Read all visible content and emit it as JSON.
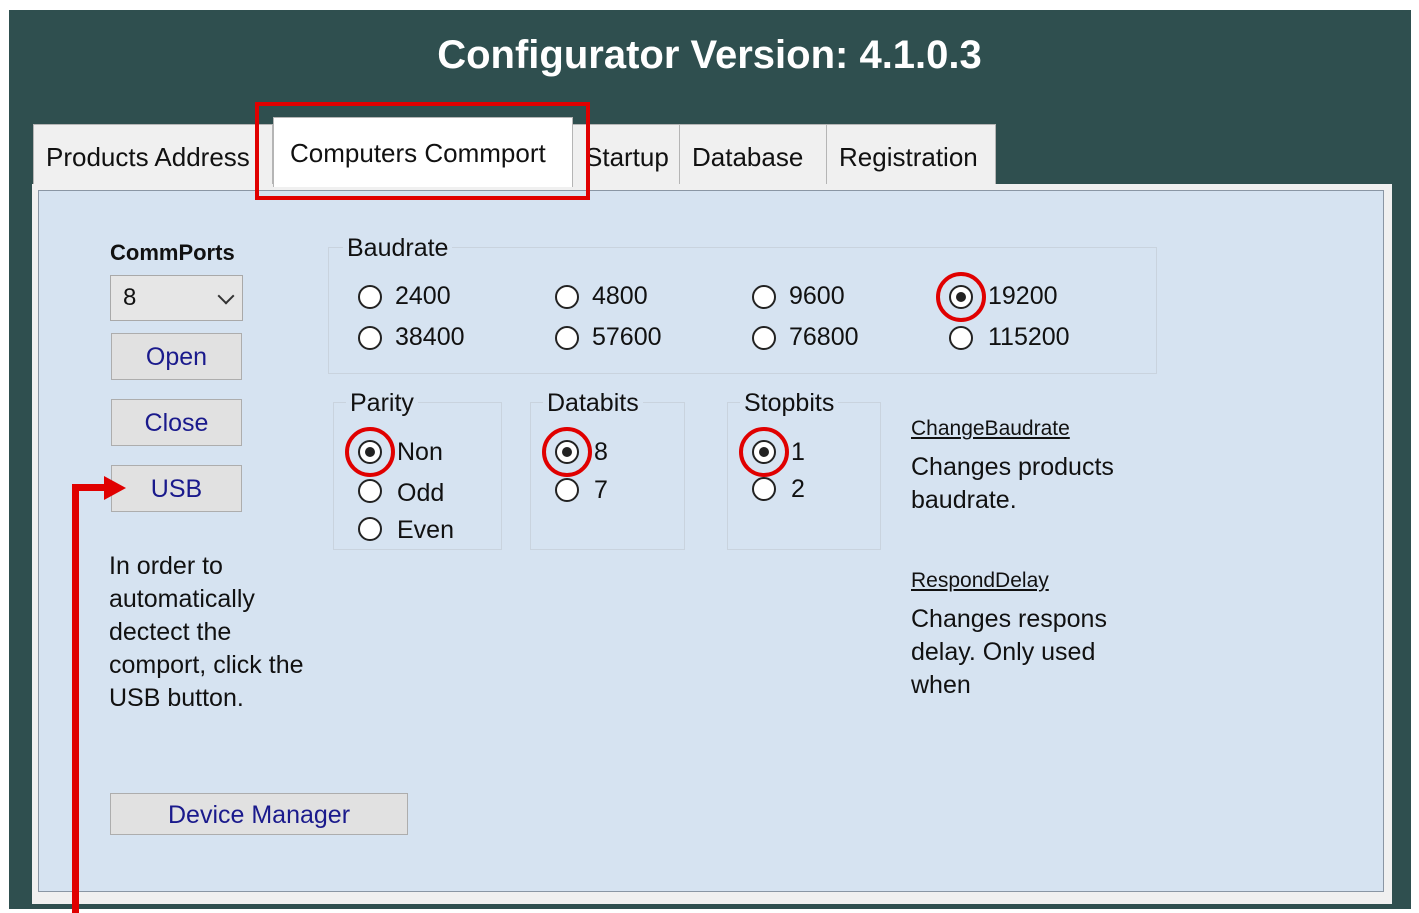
{
  "window": {
    "title": "Configurator Version: 4.1.0.3",
    "background": "#2f4f4f"
  },
  "tabs": [
    {
      "label": "Products Address",
      "active": false
    },
    {
      "label": "Computers Commport",
      "active": true
    },
    {
      "label": "Startup",
      "active": false
    },
    {
      "label": "Database",
      "active": false
    },
    {
      "label": "Registration",
      "active": false
    }
  ],
  "commports": {
    "label": "CommPorts",
    "selected": "8",
    "open_label": "Open",
    "close_label": "Close",
    "usb_label": "USB",
    "help_text": "In order to automatically dectect the comport, click the USB button.",
    "device_manager_label": "Device Manager"
  },
  "baudrate": {
    "label": "Baudrate",
    "options": [
      "2400",
      "4800",
      "9600",
      "19200",
      "38400",
      "57600",
      "76800",
      "115200"
    ],
    "selected": "19200"
  },
  "parity": {
    "label": "Parity",
    "options": [
      "Non",
      "Odd",
      "Even"
    ],
    "selected": "Non"
  },
  "databits": {
    "label": "Databits",
    "options": [
      "8",
      "7"
    ],
    "selected": "8"
  },
  "stopbits": {
    "label": "Stopbits",
    "options": [
      "1",
      "2"
    ],
    "selected": "1"
  },
  "info": {
    "change_baudrate_title": "ChangeBaudrate",
    "change_baudrate_desc": "Changes products baudrate.",
    "respond_delay_title": "RespondDelay",
    "respond_delay_desc": "Changes respons delay. Only used when"
  },
  "annotations": {
    "color": "#e00000"
  }
}
